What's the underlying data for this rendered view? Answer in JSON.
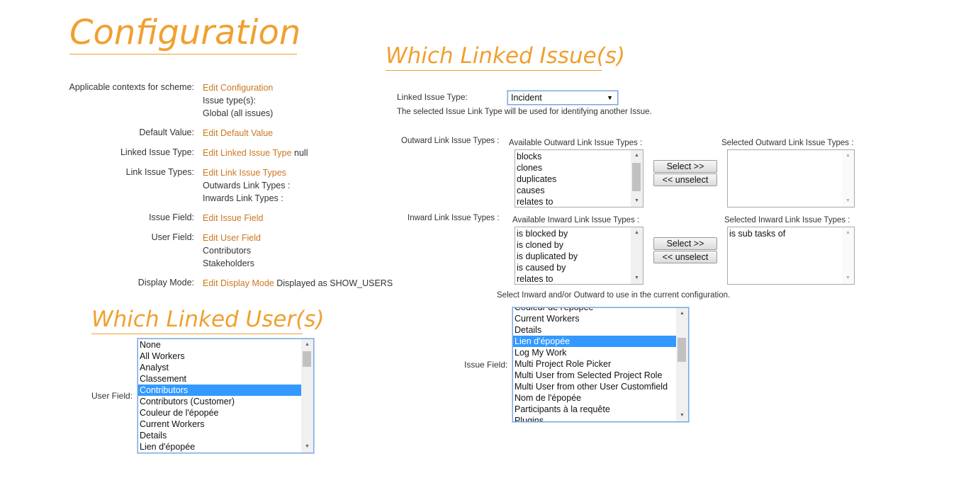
{
  "headings": {
    "configuration": "Configuration",
    "which_linked_issues": "Which Linked Issue(s)",
    "which_linked_users": "Which Linked User(s)"
  },
  "config": {
    "contexts_label": "Applicable contexts for scheme:",
    "contexts_link": "Edit Configuration",
    "contexts_line1": "Issue type(s):",
    "contexts_line2": "Global (all issues)",
    "default_label": "Default Value:",
    "default_link": "Edit Default Value",
    "lit_label": "Linked Issue Type:",
    "lit_link": "Edit Linked Issue Type",
    "lit_value": " null",
    "lits_label": "Link Issue Types:",
    "lits_link": "Edit Link Issue Types",
    "lits_line1": "Outwards Link Types :",
    "lits_line2": "Inwards Link Types :",
    "issuefield_label": "Issue Field:",
    "issuefield_link": "Edit Issue Field",
    "userfield_label": "User Field:",
    "userfield_link": "Edit User Field",
    "userfield_line1": "Contributors",
    "userfield_line2": "Stakeholders",
    "display_label": "Display Mode:",
    "display_link": "Edit Display Mode",
    "display_value": " Displayed as  SHOW_USERS"
  },
  "issues": {
    "type_label": "Linked Issue Type:",
    "type_value": "Incident",
    "type_note": "The selected Issue Link Type will be used for identifying another Issue.",
    "outward_label": "Outward Link Issue Types :",
    "outward_available_label": "Available Outward Link Issue Types :",
    "outward_available": [
      "blocks",
      "clones",
      "duplicates",
      "causes",
      "relates to"
    ],
    "outward_selected_label": "Selected Outward Link Issue Types :",
    "outward_selected": [],
    "inward_label": "Inward Link Issue Types :",
    "inward_available_label": "Available Inward Link Issue Types :",
    "inward_available": [
      "is blocked by",
      "is cloned by",
      "is duplicated by",
      "is caused by",
      "relates to"
    ],
    "inward_selected_label": "Selected Inward Link Issue Types :",
    "inward_selected": [
      "is sub tasks of"
    ],
    "select_btn": "Select >>",
    "unselect_btn": "<< unselect",
    "select_note": "Select Inward and/or Outward to use in the current configuration.",
    "issue_field_label": "Issue Field:",
    "issue_field_options": [
      "Couleur de l'épopée",
      "Current Workers",
      "Details",
      "Lien d'épopée",
      "Log My Work",
      "Multi Project Role Picker",
      "Multi User from Selected Project Role",
      "Multi User from other User Customfield",
      "Nom de l'épopée",
      "Participants à la requête",
      "Plugins"
    ],
    "issue_field_selected": "Lien d'épopée"
  },
  "users": {
    "user_field_label": "User Field:",
    "user_field_options": [
      "None",
      "All Workers",
      "Analyst",
      "Classement",
      "Contributors",
      "Contributors (Customer)",
      "Couleur de l'épopée",
      "Current Workers",
      "Details",
      "Lien d'épopée"
    ],
    "user_field_selected": "Contributors"
  },
  "icons": {
    "scroll_up": "scroll-up-arrow-icon",
    "scroll_down": "scroll-down-arrow-icon",
    "dropdown": "dropdown-caret-icon"
  },
  "colors": {
    "accent": "#f0a030",
    "link": "#cc7722",
    "selection": "#3399ff"
  }
}
